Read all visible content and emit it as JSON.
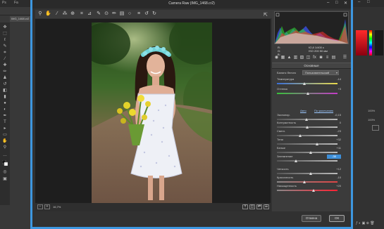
{
  "photoshop": {
    "menu_items": [
      "Ps",
      "Fa"
    ],
    "doc_tab": "IMG_1468.cr2",
    "window_controls": [
      "–",
      "□"
    ],
    "swatch_colors": [
      "#c0001a",
      "#1a1a1a",
      "#6a1a1a"
    ],
    "right_labels": [
      "100%",
      "100%"
    ]
  },
  "dialog": {
    "title": "Camera Raw (IMG_1468.cr2)",
    "window_controls": [
      "–",
      "□",
      "✕"
    ],
    "toolbar_icons": [
      "zoom-icon",
      "hand-icon",
      "white-balance-icon",
      "color-sampler-icon",
      "target-adjust-icon",
      "crop-icon",
      "straighten-icon",
      "spot-removal-icon",
      "red-eye-icon",
      "adjustment-brush-icon",
      "graduated-filter-icon",
      "radial-filter-icon",
      "preferences-icon",
      "rotate-ccw-icon",
      "rotate-cw-icon"
    ],
    "zoom_level": "16,7%",
    "cancel_label": "Отмена",
    "ok_label": "ОК",
    "accent_color": "#3d97e0"
  },
  "panel": {
    "info": {
      "r": "R:",
      "g": "G:",
      "b": "B:",
      "camera_line1": "f/2,8      1/400 с",
      "camera_line2": "ISO 200    50 мм"
    },
    "section_title": "Основные",
    "wb_label": "Баланс белого",
    "wb_value": "Пользовательский",
    "auto_label": "Авто",
    "default_label": "По умолчанию",
    "sliders": [
      {
        "label": "Температура",
        "value": "-14",
        "position": 0.45,
        "track": "temp"
      },
      {
        "label": "Оттенок",
        "value": "+3",
        "position": 0.51,
        "track": "tint"
      },
      {
        "label": "Экспонир.",
        "value": "-0,15",
        "position": 0.49,
        "track": "gray"
      },
      {
        "label": "Контрастность",
        "value": "0",
        "position": 0.5,
        "track": "gray"
      },
      {
        "label": "Светл.",
        "value": "-23",
        "position": 0.38,
        "track": "gray"
      },
      {
        "label": "Тени",
        "value": "+32",
        "position": 0.66,
        "track": "gray"
      },
      {
        "label": "Белые",
        "value": "+11",
        "position": 0.56,
        "track": "gray"
      },
      {
        "label": "Затемнение",
        "value": "-38",
        "position": 0.31,
        "track": "gray",
        "highlight": true
      },
      {
        "label": "Четкость",
        "value": "+12",
        "position": 0.56,
        "track": "gray"
      },
      {
        "label": "Красочность",
        "value": "-10",
        "position": 0.45,
        "track": "vib"
      },
      {
        "label": "Насыщенность",
        "value": "+20",
        "position": 0.6,
        "track": "sat"
      }
    ]
  }
}
